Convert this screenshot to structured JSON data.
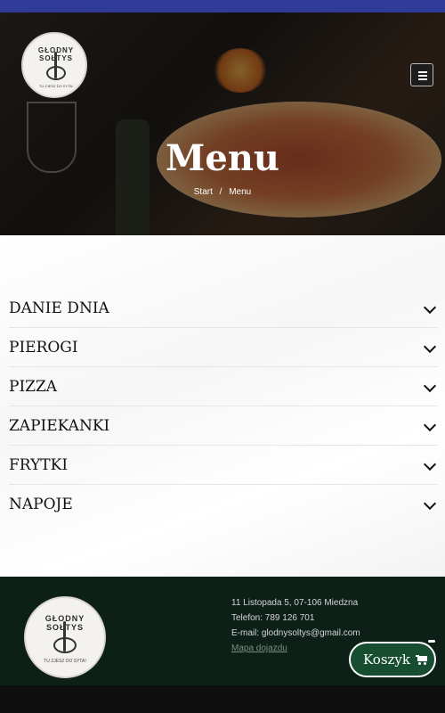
{
  "colors": {
    "topbar": "#2e3c97",
    "footer_bg": "#0d2018",
    "cart_bg": "#174d31"
  },
  "header": {
    "logo": {
      "name": "GŁODNY SOŁTYS",
      "slogan": "TU ZJESZ DO SYTA!"
    },
    "menu_icon": "hamburger-icon"
  },
  "hero": {
    "title": "Menu",
    "breadcrumb": {
      "home": "Start",
      "separator": "/",
      "current": "Menu"
    }
  },
  "categories": [
    {
      "label": "DANIE DNIA",
      "icon": "chevron-down-icon"
    },
    {
      "label": "PIEROGI",
      "icon": "chevron-down-icon"
    },
    {
      "label": "PIZZA",
      "icon": "chevron-down-icon"
    },
    {
      "label": "ZAPIEKANKI",
      "icon": "chevron-down-icon"
    },
    {
      "label": "FRYTKI",
      "icon": "chevron-down-icon"
    },
    {
      "label": "NAPOJE",
      "icon": "chevron-down-icon"
    }
  ],
  "footer": {
    "logo": {
      "name": "GŁODNY SOŁTYS",
      "slogan": "TU ZJESZ DO SYTA!"
    },
    "address": "11 Listopada 5, 07-106 Miedzna",
    "phone": "Telefon: 789 126 701",
    "email": "E-mail: glodnysoltys@gmail.com",
    "map_link": "Mapa dojazdu"
  },
  "cart": {
    "label": "Koszyk",
    "icon": "cart-icon"
  }
}
